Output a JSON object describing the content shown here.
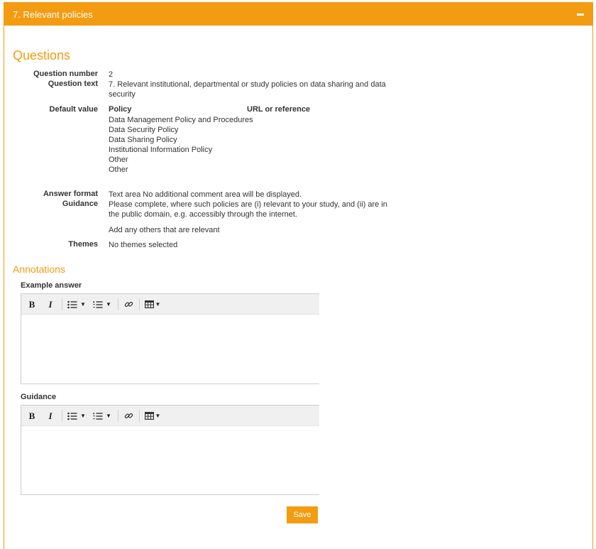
{
  "panel": {
    "title": "7. Relevant policies"
  },
  "questions": {
    "heading": "Questions",
    "question_number_label": "Question number",
    "question_number": "2",
    "question_text_label": "Question text",
    "question_text": "7. Relevant institutional, departmental or study policies on data sharing and data security",
    "default_value_label": "Default value",
    "policy_col": "Policy",
    "url_col": "URL or reference",
    "policies": [
      "Data Management Policy and Procedures",
      "Data Security Policy",
      "Data Sharing Policy",
      "Institutional Information Policy",
      "Other",
      "Other"
    ],
    "answer_format_label": "Answer format",
    "answer_format": "Text area No additional comment area will be displayed.",
    "guidance_label": "Guidance",
    "guidance_line1": "Please complete, where such policies are (i) relevant to your study, and (ii) are in the public domain, e.g. accessibly through the internet.",
    "guidance_line2": "Add any others that are relevant",
    "themes_label": "Themes",
    "themes": "No themes selected"
  },
  "annotations": {
    "heading": "Annotations",
    "example_answer_label": "Example answer",
    "guidance_label": "Guidance"
  },
  "toolbar": {
    "bold": "B",
    "italic": "I"
  },
  "save_label": "Save",
  "colors": {
    "accent": "#f39c12"
  }
}
